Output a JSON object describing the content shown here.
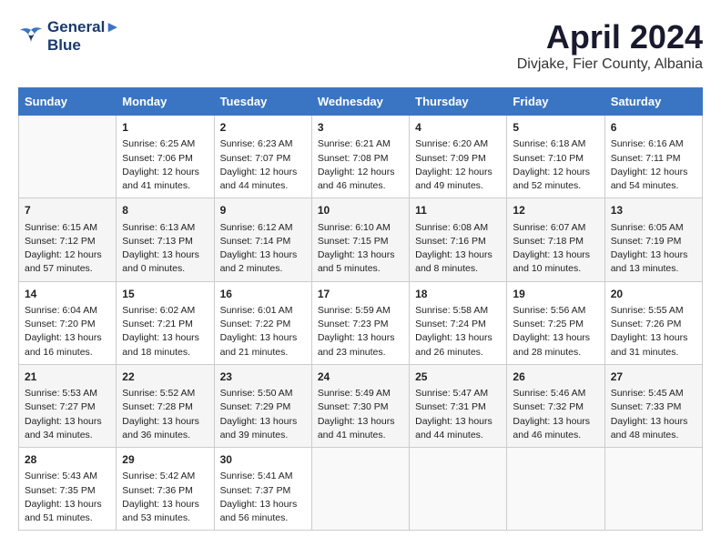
{
  "header": {
    "logo_line1": "General",
    "logo_line2": "Blue",
    "title": "April 2024",
    "subtitle": "Divjake, Fier County, Albania"
  },
  "days_of_week": [
    "Sunday",
    "Monday",
    "Tuesday",
    "Wednesday",
    "Thursday",
    "Friday",
    "Saturday"
  ],
  "weeks": [
    [
      {
        "day": null,
        "info": ""
      },
      {
        "day": "1",
        "info": "Sunrise: 6:25 AM\nSunset: 7:06 PM\nDaylight: 12 hours\nand 41 minutes."
      },
      {
        "day": "2",
        "info": "Sunrise: 6:23 AM\nSunset: 7:07 PM\nDaylight: 12 hours\nand 44 minutes."
      },
      {
        "day": "3",
        "info": "Sunrise: 6:21 AM\nSunset: 7:08 PM\nDaylight: 12 hours\nand 46 minutes."
      },
      {
        "day": "4",
        "info": "Sunrise: 6:20 AM\nSunset: 7:09 PM\nDaylight: 12 hours\nand 49 minutes."
      },
      {
        "day": "5",
        "info": "Sunrise: 6:18 AM\nSunset: 7:10 PM\nDaylight: 12 hours\nand 52 minutes."
      },
      {
        "day": "6",
        "info": "Sunrise: 6:16 AM\nSunset: 7:11 PM\nDaylight: 12 hours\nand 54 minutes."
      }
    ],
    [
      {
        "day": "7",
        "info": "Sunrise: 6:15 AM\nSunset: 7:12 PM\nDaylight: 12 hours\nand 57 minutes."
      },
      {
        "day": "8",
        "info": "Sunrise: 6:13 AM\nSunset: 7:13 PM\nDaylight: 13 hours\nand 0 minutes."
      },
      {
        "day": "9",
        "info": "Sunrise: 6:12 AM\nSunset: 7:14 PM\nDaylight: 13 hours\nand 2 minutes."
      },
      {
        "day": "10",
        "info": "Sunrise: 6:10 AM\nSunset: 7:15 PM\nDaylight: 13 hours\nand 5 minutes."
      },
      {
        "day": "11",
        "info": "Sunrise: 6:08 AM\nSunset: 7:16 PM\nDaylight: 13 hours\nand 8 minutes."
      },
      {
        "day": "12",
        "info": "Sunrise: 6:07 AM\nSunset: 7:18 PM\nDaylight: 13 hours\nand 10 minutes."
      },
      {
        "day": "13",
        "info": "Sunrise: 6:05 AM\nSunset: 7:19 PM\nDaylight: 13 hours\nand 13 minutes."
      }
    ],
    [
      {
        "day": "14",
        "info": "Sunrise: 6:04 AM\nSunset: 7:20 PM\nDaylight: 13 hours\nand 16 minutes."
      },
      {
        "day": "15",
        "info": "Sunrise: 6:02 AM\nSunset: 7:21 PM\nDaylight: 13 hours\nand 18 minutes."
      },
      {
        "day": "16",
        "info": "Sunrise: 6:01 AM\nSunset: 7:22 PM\nDaylight: 13 hours\nand 21 minutes."
      },
      {
        "day": "17",
        "info": "Sunrise: 5:59 AM\nSunset: 7:23 PM\nDaylight: 13 hours\nand 23 minutes."
      },
      {
        "day": "18",
        "info": "Sunrise: 5:58 AM\nSunset: 7:24 PM\nDaylight: 13 hours\nand 26 minutes."
      },
      {
        "day": "19",
        "info": "Sunrise: 5:56 AM\nSunset: 7:25 PM\nDaylight: 13 hours\nand 28 minutes."
      },
      {
        "day": "20",
        "info": "Sunrise: 5:55 AM\nSunset: 7:26 PM\nDaylight: 13 hours\nand 31 minutes."
      }
    ],
    [
      {
        "day": "21",
        "info": "Sunrise: 5:53 AM\nSunset: 7:27 PM\nDaylight: 13 hours\nand 34 minutes."
      },
      {
        "day": "22",
        "info": "Sunrise: 5:52 AM\nSunset: 7:28 PM\nDaylight: 13 hours\nand 36 minutes."
      },
      {
        "day": "23",
        "info": "Sunrise: 5:50 AM\nSunset: 7:29 PM\nDaylight: 13 hours\nand 39 minutes."
      },
      {
        "day": "24",
        "info": "Sunrise: 5:49 AM\nSunset: 7:30 PM\nDaylight: 13 hours\nand 41 minutes."
      },
      {
        "day": "25",
        "info": "Sunrise: 5:47 AM\nSunset: 7:31 PM\nDaylight: 13 hours\nand 44 minutes."
      },
      {
        "day": "26",
        "info": "Sunrise: 5:46 AM\nSunset: 7:32 PM\nDaylight: 13 hours\nand 46 minutes."
      },
      {
        "day": "27",
        "info": "Sunrise: 5:45 AM\nSunset: 7:33 PM\nDaylight: 13 hours\nand 48 minutes."
      }
    ],
    [
      {
        "day": "28",
        "info": "Sunrise: 5:43 AM\nSunset: 7:35 PM\nDaylight: 13 hours\nand 51 minutes."
      },
      {
        "day": "29",
        "info": "Sunrise: 5:42 AM\nSunset: 7:36 PM\nDaylight: 13 hours\nand 53 minutes."
      },
      {
        "day": "30",
        "info": "Sunrise: 5:41 AM\nSunset: 7:37 PM\nDaylight: 13 hours\nand 56 minutes."
      },
      {
        "day": null,
        "info": ""
      },
      {
        "day": null,
        "info": ""
      },
      {
        "day": null,
        "info": ""
      },
      {
        "day": null,
        "info": ""
      }
    ]
  ]
}
